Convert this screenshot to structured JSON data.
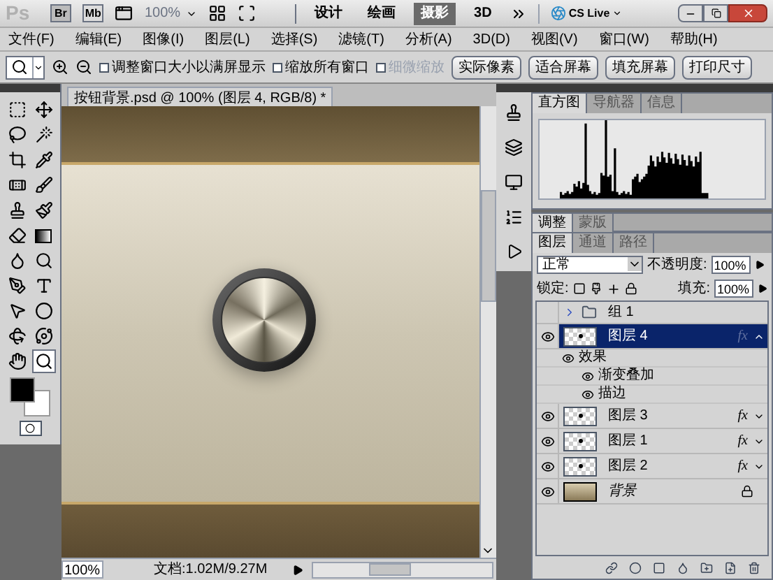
{
  "app_bar": {
    "logo": "Ps",
    "bridge": "Br",
    "mini_bridge": "Mb",
    "zoom": "100%",
    "workspaces": [
      {
        "label": "设计",
        "selected": false
      },
      {
        "label": "绘画",
        "selected": false
      },
      {
        "label": "摄影",
        "selected": true
      },
      {
        "label": "3D",
        "selected": false
      }
    ],
    "cs_live": "CS Live"
  },
  "menu": [
    "文件(F)",
    "编辑(E)",
    "图像(I)",
    "图层(L)",
    "选择(S)",
    "滤镜(T)",
    "分析(A)",
    "3D(D)",
    "视图(V)",
    "窗口(W)",
    "帮助(H)"
  ],
  "options_bar": {
    "checkboxes": [
      {
        "label": "调整窗口大小以满屏显示",
        "checked": false,
        "disabled": false
      },
      {
        "label": "缩放所有窗口",
        "checked": false,
        "disabled": false
      },
      {
        "label": "细微缩放",
        "checked": false,
        "disabled": true
      }
    ],
    "buttons": [
      "实际像素",
      "适合屏幕",
      "填充屏幕",
      "打印尺寸"
    ]
  },
  "toolbox": {
    "tools": [
      {
        "kind": "marquee",
        "selected": false
      },
      {
        "kind": "move",
        "selected": false
      },
      {
        "kind": "lasso",
        "selected": false
      },
      {
        "kind": "wand",
        "selected": false
      },
      {
        "kind": "crop",
        "selected": false
      },
      {
        "kind": "eyedropper",
        "selected": false
      },
      {
        "kind": "healing",
        "selected": false
      },
      {
        "kind": "brush",
        "selected": false
      },
      {
        "kind": "stamp",
        "selected": false
      },
      {
        "kind": "history",
        "selected": false
      },
      {
        "kind": "eraser",
        "selected": false
      },
      {
        "kind": "gradient",
        "selected": false
      },
      {
        "kind": "blur",
        "selected": false
      },
      {
        "kind": "dodge",
        "selected": false
      },
      {
        "kind": "pen",
        "selected": false
      },
      {
        "kind": "type",
        "selected": false
      },
      {
        "kind": "path",
        "selected": false
      },
      {
        "kind": "shape",
        "selected": false
      },
      {
        "kind": "rotate3d",
        "selected": false
      },
      {
        "kind": "orbit3d",
        "selected": false
      },
      {
        "kind": "hand",
        "selected": false
      },
      {
        "kind": "zoom",
        "selected": true
      }
    ]
  },
  "document": {
    "title": "按钮背景.psd @ 100% (图层 4, RGB/8) *",
    "zoom": "100%",
    "status": "文档:1.02M/9.27M"
  },
  "histogram_panel": {
    "tabs": [
      {
        "label": "直方图",
        "selected": true
      },
      {
        "label": "导航器",
        "selected": false
      },
      {
        "label": "信息",
        "selected": false
      }
    ]
  },
  "adjustments_panel": {
    "tabs": [
      {
        "label": "调整",
        "selected": true
      },
      {
        "label": "蒙版",
        "selected": false
      }
    ]
  },
  "layers_panel": {
    "tabs": [
      {
        "label": "图层",
        "selected": true
      },
      {
        "label": "通道",
        "selected": false
      },
      {
        "label": "路径",
        "selected": false
      }
    ],
    "blend_mode": "正常",
    "opacity_label": "不透明度:",
    "opacity": "100%",
    "lock_label": "锁定:",
    "fill_label": "填充:",
    "fill": "100%",
    "layers": [
      {
        "name": "组 1",
        "kind": "group",
        "visible": false,
        "selected": false,
        "expanded": false
      },
      {
        "name": "图层 4",
        "kind": "layer",
        "visible": true,
        "selected": true,
        "fx": "fx",
        "expanded": true,
        "children": [
          {
            "name": "效果",
            "visible": true,
            "children": [
              {
                "name": "渐变叠加",
                "visible": true
              },
              {
                "name": "描边",
                "visible": true
              }
            ]
          }
        ]
      },
      {
        "name": "图层 3",
        "kind": "layer",
        "visible": true,
        "selected": false,
        "fx": "fx",
        "expanded": false
      },
      {
        "name": "图层 1",
        "kind": "layer",
        "visible": true,
        "selected": false,
        "fx": "fx",
        "expanded": false
      },
      {
        "name": "图层 2",
        "kind": "layer",
        "visible": true,
        "selected": false,
        "fx": "fx",
        "expanded": false
      },
      {
        "name": "背景",
        "kind": "background",
        "visible": true,
        "selected": false,
        "locked": true
      }
    ]
  }
}
